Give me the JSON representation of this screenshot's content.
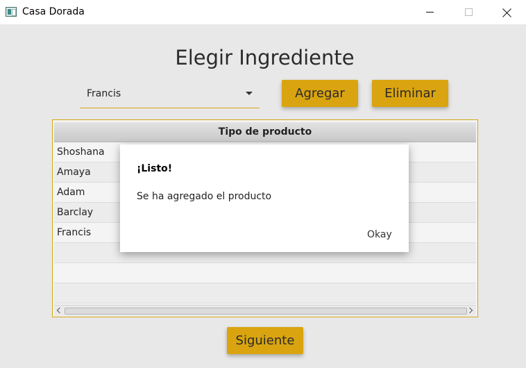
{
  "window": {
    "title": "Casa Dorada"
  },
  "page": {
    "heading": "Elegir Ingrediente"
  },
  "combo": {
    "selected": "Francis"
  },
  "buttons": {
    "agregar": "Agregar",
    "eliminar": "Eliminar",
    "siguiente": "Siguiente"
  },
  "table": {
    "column_header": "Tipo de producto",
    "rows": [
      "Shoshana",
      "Amaya",
      "Adam",
      "Barclay",
      "Francis",
      "",
      "",
      ""
    ]
  },
  "dialog": {
    "title": "¡Listo!",
    "message": "Se ha agregado el producto",
    "ok_label": "Okay"
  },
  "colors": {
    "accent": "#d9a40f",
    "background": "#e8e8e8"
  }
}
